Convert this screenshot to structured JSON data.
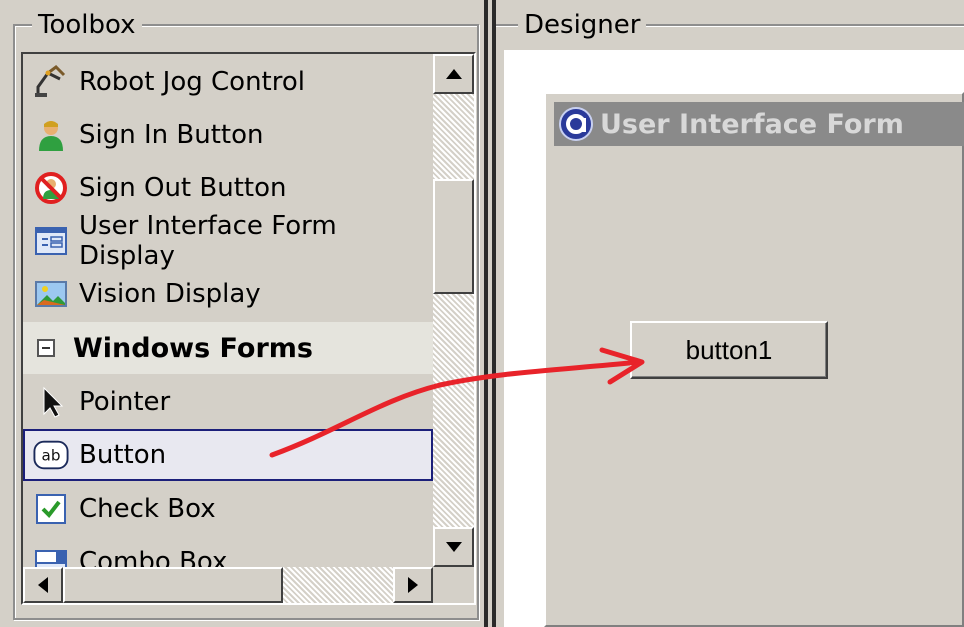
{
  "toolbox": {
    "title": "Toolbox",
    "items": [
      {
        "label": "Robot Jog Control",
        "icon": "robot-arm-icon"
      },
      {
        "label": "Sign In Button",
        "icon": "user-sign-in-icon"
      },
      {
        "label": "Sign Out Button",
        "icon": "sign-out-icon"
      },
      {
        "label": "User Interface Form Display",
        "icon": "form-display-icon"
      },
      {
        "label": "Vision Display",
        "icon": "vision-display-icon"
      }
    ],
    "category": {
      "label": "Windows Forms",
      "expander": "minus"
    },
    "form_items": [
      {
        "label": "Pointer",
        "icon": "pointer-icon"
      },
      {
        "label": "Button",
        "icon": "button-icon",
        "icon_text": "ab",
        "selected": true
      },
      {
        "label": "Check Box",
        "icon": "checkbox-icon"
      },
      {
        "label": "Combo Box",
        "icon": "combobox-icon"
      }
    ]
  },
  "designer": {
    "title": "Designer",
    "form": {
      "title": "User Interface Form",
      "button_label": "button1"
    }
  },
  "colors": {
    "window_bg": "#d4d0c8",
    "selection_border": "#1b1f7a",
    "arrow": "#e8232a",
    "titlebar": "#8a8a8a"
  }
}
